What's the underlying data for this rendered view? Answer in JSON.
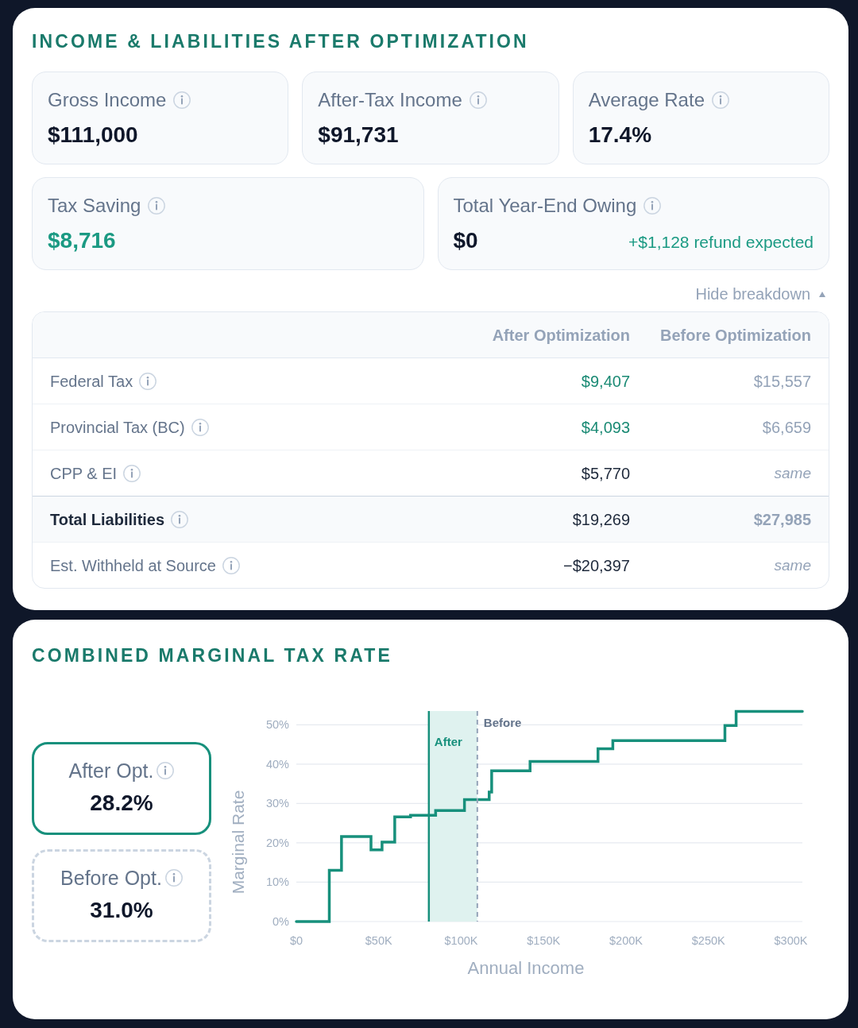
{
  "summary_panel": {
    "title": "INCOME & LIABILITIES AFTER OPTIMIZATION",
    "stat_rows": [
      {
        "cards": [
          {
            "label": "Gross Income",
            "value": "$111,000",
            "highlight": false
          },
          {
            "label": "After-Tax Income",
            "value": "$91,731",
            "highlight": false
          },
          {
            "label": "Average Rate",
            "value": "17.4%",
            "highlight": false
          }
        ]
      },
      {
        "cards": [
          {
            "label": "Tax Saving",
            "value": "$8,716",
            "highlight": true
          },
          {
            "label": "Total Year-End Owing",
            "value": "$0",
            "highlight": false,
            "note": "+$1,128 refund expected"
          }
        ]
      }
    ],
    "breakdown_toggle": {
      "label": "Hide breakdown",
      "expanded": true
    },
    "breakdown_table": {
      "columns": [
        "After Optimization",
        "Before Optimization"
      ],
      "rows": [
        {
          "label": "Federal Tax",
          "after": "$9,407",
          "before": "$15,557",
          "improved": true,
          "unchanged": false,
          "total": false
        },
        {
          "label": "Provincial Tax (BC)",
          "after": "$4,093",
          "before": "$6,659",
          "improved": true,
          "unchanged": false,
          "total": false
        },
        {
          "label": "CPP & EI",
          "after": "$5,770",
          "before": "same",
          "improved": false,
          "unchanged": true,
          "total": false
        },
        {
          "label": "Total Liabilities",
          "after": "$19,269",
          "before": "$27,985",
          "improved": false,
          "unchanged": false,
          "total": true
        },
        {
          "label": "Est. Withheld at Source",
          "after": "−$20,397",
          "before": "same",
          "improved": false,
          "unchanged": true,
          "total": false
        }
      ]
    }
  },
  "rate_panel": {
    "title": "COMBINED MARGINAL TAX RATE",
    "rates": [
      {
        "label": "After Opt.",
        "value": "28.2%",
        "selected": true
      },
      {
        "label": "Before Opt.",
        "value": "31.0%",
        "selected": false
      }
    ],
    "chart_data": {
      "type": "line",
      "xlabel": "Annual Income",
      "ylabel": "Marginal Rate",
      "grid": true,
      "x": [
        0,
        20000,
        20000,
        27400,
        27400,
        45300,
        45300,
        52000,
        52000,
        59700,
        59700,
        69300,
        69300,
        84500,
        84500,
        102000,
        102000,
        117000,
        117000,
        118500,
        118500,
        141800,
        141800,
        183000,
        183000,
        192000,
        192000,
        260000,
        260000,
        266800,
        266800,
        307000
      ],
      "series": [
        {
          "color": "#17907c",
          "values": [
            0,
            0,
            13,
            13,
            21.6,
            21.6,
            18.2,
            18.2,
            20.2,
            20.2,
            26.6,
            26.6,
            27.0,
            27.0,
            28.2,
            28.2,
            31.0,
            31.0,
            32.9,
            32.9,
            38.3,
            38.3,
            40.7,
            40.7,
            43.9,
            43.9,
            46.0,
            46.0,
            49.8,
            49.8,
            53.4,
            53.4
          ]
        }
      ],
      "xlim": [
        0,
        307000
      ],
      "ylim": [
        0,
        53.5
      ],
      "xticks": [
        {
          "value": 0,
          "label": "$0"
        },
        {
          "value": 50000,
          "label": "$50K"
        },
        {
          "value": 100000,
          "label": "$100K"
        },
        {
          "value": 150000,
          "label": "$150K"
        },
        {
          "value": 200000,
          "label": "$200K"
        },
        {
          "value": 250000,
          "label": "$250K"
        },
        {
          "value": 300000,
          "label": "$300K"
        }
      ],
      "yticks": [
        {
          "value": 0,
          "label": "0%"
        },
        {
          "value": 10,
          "label": "10%"
        },
        {
          "value": 20,
          "label": "20%"
        },
        {
          "value": 30,
          "label": "30%"
        },
        {
          "value": 40,
          "label": "40%"
        },
        {
          "value": 50,
          "label": "50%"
        }
      ],
      "ref_lines": [
        {
          "axis": "x",
          "value": 80400,
          "label": "After",
          "color": "#17907c"
        },
        {
          "axis": "x",
          "value": 109800,
          "label": "Before",
          "color": "#94a3b8"
        }
      ],
      "bands": [
        {
          "axis": "x",
          "from": 80400,
          "to": 109800,
          "color": "#dff2ef"
        }
      ]
    }
  }
}
